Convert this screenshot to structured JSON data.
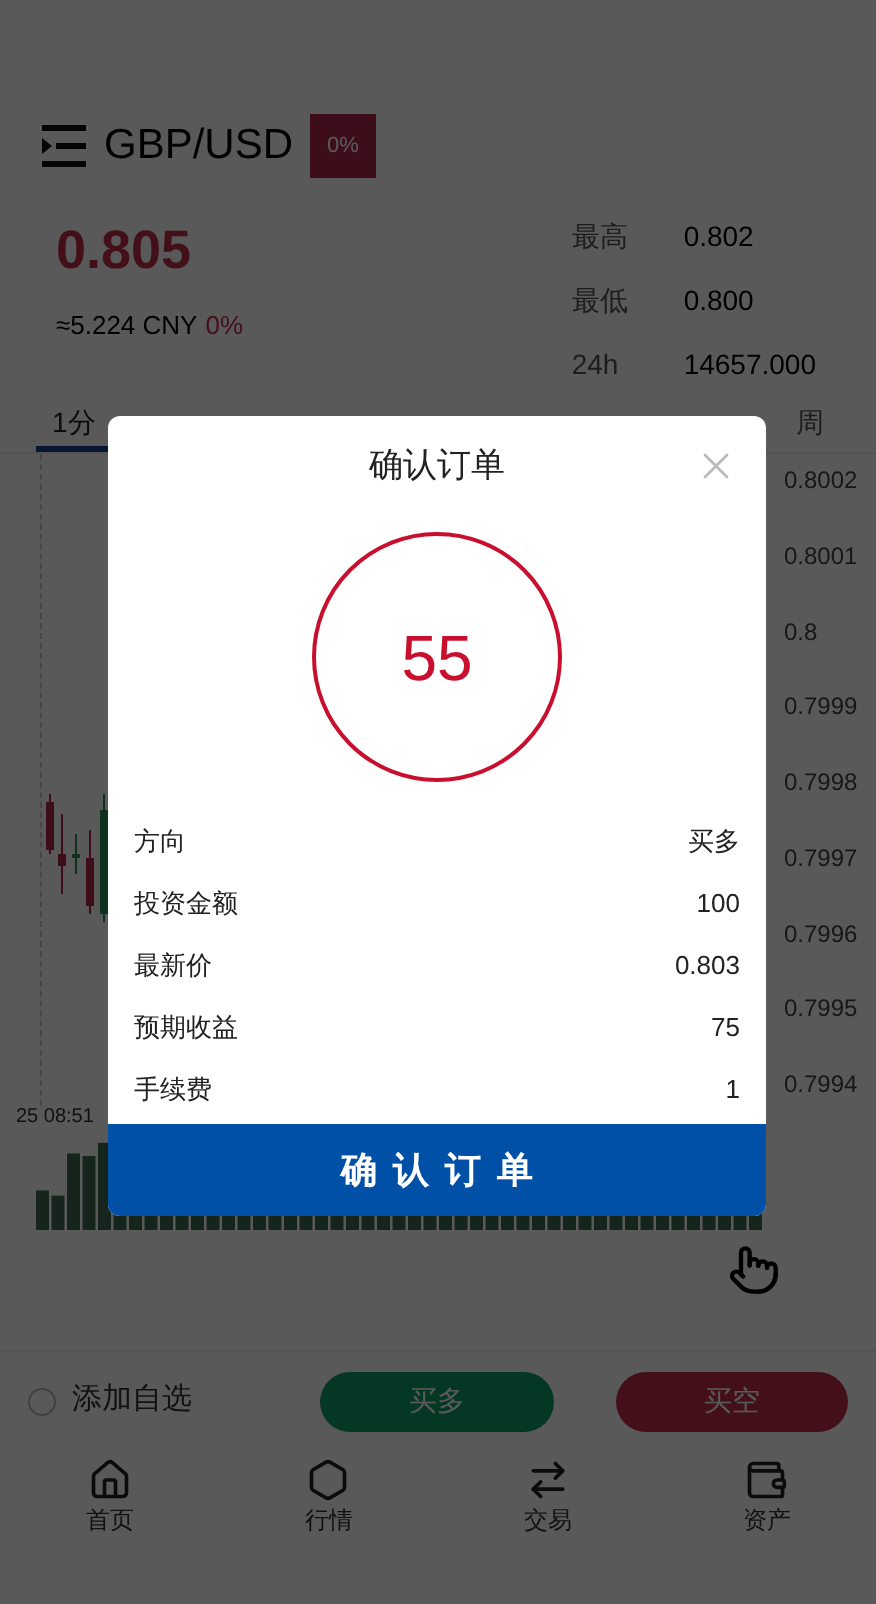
{
  "header": {
    "symbol": "GBP/USD",
    "change_badge": "0%"
  },
  "price": {
    "last": "0.805",
    "cny": "≈5.224 CNY",
    "change": "0%"
  },
  "stats": [
    {
      "label": "最高",
      "value": "0.802"
    },
    {
      "label": "最低",
      "value": "0.800"
    },
    {
      "label": "24h",
      "value": "14657.000"
    }
  ],
  "tabs": [
    {
      "label": "1分",
      "selected": true
    },
    {
      "label": "周",
      "selected": false
    }
  ],
  "chart": {
    "y_axis_labels": [
      "0.8002",
      "0.8001",
      "0.8",
      "0.7999",
      "0.7998",
      "0.7997",
      "0.7996",
      "0.7995",
      "0.7994"
    ],
    "time_label": "25 08:51"
  },
  "actions": {
    "watchlist": {
      "label": "添加自选",
      "checked": false
    },
    "buy_long": "买多",
    "buy_short": "买空"
  },
  "nav": [
    {
      "label": "首页",
      "kind": "home"
    },
    {
      "label": "行情",
      "kind": "market"
    },
    {
      "label": "交易",
      "kind": "trade"
    },
    {
      "label": "资产",
      "kind": "assets"
    }
  ],
  "dialog": {
    "title": "确认订单",
    "countdown": "55",
    "rows": [
      {
        "label": "方向",
        "value": "买多"
      },
      {
        "label": "投资金额",
        "value": "100"
      },
      {
        "label": "最新价",
        "value": "0.803"
      },
      {
        "label": "预期收益",
        "value": "75"
      },
      {
        "label": "手续费",
        "value": "1"
      }
    ],
    "confirm": "确认订单"
  }
}
